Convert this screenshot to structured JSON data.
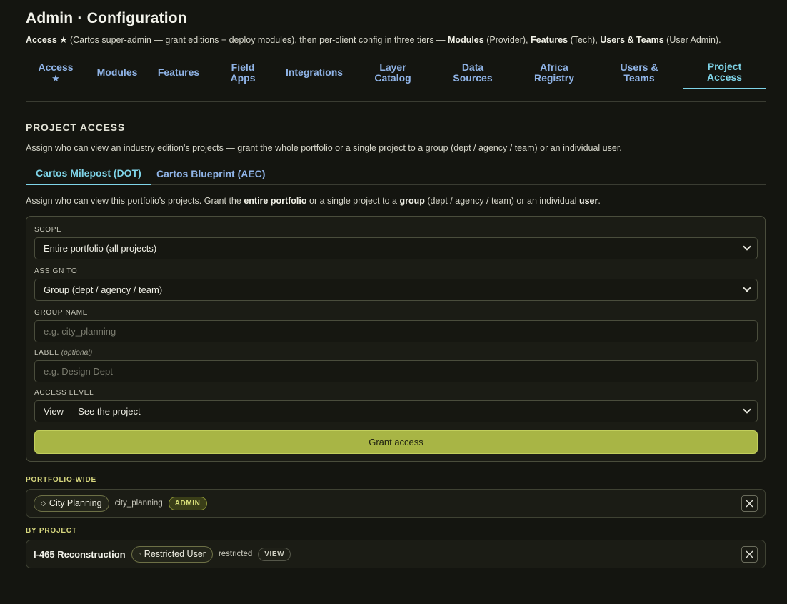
{
  "header": {
    "title": "Admin · Configuration",
    "subtitle": {
      "s1": "Access ★",
      "s2": " (Cartos super-admin — grant editions + deploy modules), then per-client config in three tiers — ",
      "s3": "Modules",
      "s4": " (Provider), ",
      "s5": "Features",
      "s6": " (Tech), ",
      "s7": "Users & Teams",
      "s8": " (User Admin)."
    }
  },
  "tabs": [
    {
      "line1": "Access",
      "line2": "★"
    },
    {
      "line1": "Modules",
      "line2": ""
    },
    {
      "line1": "Features",
      "line2": ""
    },
    {
      "line1": "Field",
      "line2": "Apps"
    },
    {
      "line1": "Integrations",
      "line2": ""
    },
    {
      "line1": "Layer",
      "line2": "Catalog"
    },
    {
      "line1": "Data",
      "line2": "Sources"
    },
    {
      "line1": "Africa",
      "line2": "Registry"
    },
    {
      "line1": "Users &",
      "line2": "Teams"
    },
    {
      "line1": "Project",
      "line2": "Access"
    }
  ],
  "section": {
    "title": "PROJECT ACCESS",
    "description": "Assign who can view an industry edition's projects — grant the whole portfolio or a single project to a group (dept / agency / team) or an individual user."
  },
  "subtabs": [
    "Cartos Milepost (DOT)",
    "Cartos Blueprint (AEC)"
  ],
  "portfolio_desc": {
    "p1": "Assign who can view this portfolio's projects. Grant the ",
    "p2": "entire portfolio",
    "p3": " or a single project to a ",
    "p4": "group",
    "p5": " (dept / agency / team) or an individual ",
    "p6": "user",
    "p7": "."
  },
  "form": {
    "scope_label": "SCOPE",
    "scope_value": "Entire portfolio (all projects)",
    "assign_label": "ASSIGN TO",
    "assign_value": "Group (dept / agency / team)",
    "group_label": "GROUP NAME",
    "group_placeholder": "e.g. city_planning",
    "label_label": "LABEL",
    "label_optional": "(optional)",
    "label_placeholder": "e.g. Design Dept",
    "access_label": "ACCESS LEVEL",
    "access_value": "View — See the project",
    "grant_button": "Grant access"
  },
  "portfolio_wide": {
    "title": "PORTFOLIO-WIDE",
    "entry": {
      "name": "City Planning",
      "glyph": "◇",
      "id": "city_planning",
      "badge": "ADMIN"
    }
  },
  "by_project": {
    "title": "BY PROJECT",
    "entry": {
      "project": "I-465 Reconstruction",
      "name": "Restricted User",
      "glyph": "▫",
      "id": "restricted",
      "badge": "VIEW"
    }
  },
  "colors": {
    "accent": "#7fd4e8",
    "tab_link": "#8fb3e6",
    "primary_button": "#a8b545",
    "background": "#141510"
  }
}
